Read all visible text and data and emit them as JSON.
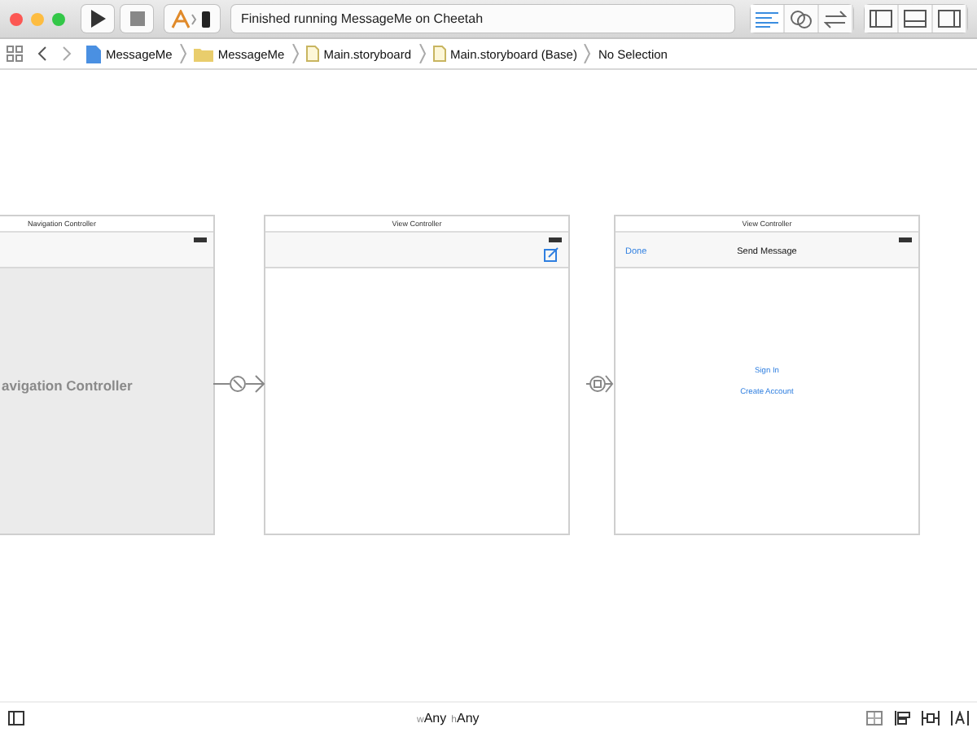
{
  "toolbar": {
    "status": "Finished running MessageMe on Cheetah"
  },
  "path_bar": {
    "items": [
      {
        "label": "MessageMe",
        "kind": "project"
      },
      {
        "label": "MessageMe",
        "kind": "folder"
      },
      {
        "label": "Main.storyboard",
        "kind": "file"
      },
      {
        "label": "Main.storyboard (Base)",
        "kind": "file"
      },
      {
        "label": "No Selection",
        "kind": "plain"
      }
    ]
  },
  "scenes": [
    {
      "kind": "navigation",
      "title": "Navigation Controller",
      "body_label": "avigation Controller"
    },
    {
      "kind": "compose",
      "title": "View Controller"
    },
    {
      "kind": "message",
      "title": "View Controller",
      "left_button": "Done",
      "nav_title": "Send Message",
      "links": [
        "Sign In",
        "Create Account"
      ]
    }
  ],
  "bottom_bar": {
    "w_prefix": "w",
    "w_value": "Any",
    "h_prefix": "h",
    "h_value": "Any"
  }
}
